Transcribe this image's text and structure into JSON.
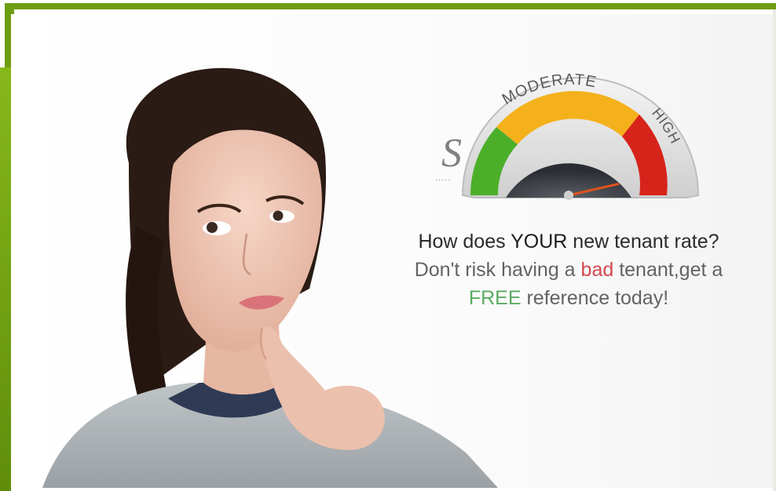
{
  "gauge": {
    "labels": {
      "moderate": "MODERATE",
      "high": "HIGH"
    },
    "level": 0.85,
    "colors": {
      "low": "#4caf2a",
      "moderate": "#f4b11c",
      "high": "#d6241b"
    }
  },
  "watermark": {
    "letter": "S",
    "dots": "....."
  },
  "caption": {
    "line1_a": "How does ",
    "line1_highlight": "YOUR",
    "line1_b": " new tenant rate?",
    "line2_a": "Don't risk having a ",
    "line2_highlight": "bad",
    "line2_b": " tenant,get a",
    "line3_highlight": "FREE",
    "line3_b": " reference today!"
  },
  "colors": {
    "brand_green": "#6f9d10",
    "bad": "#d3484d",
    "free": "#5aab61"
  }
}
